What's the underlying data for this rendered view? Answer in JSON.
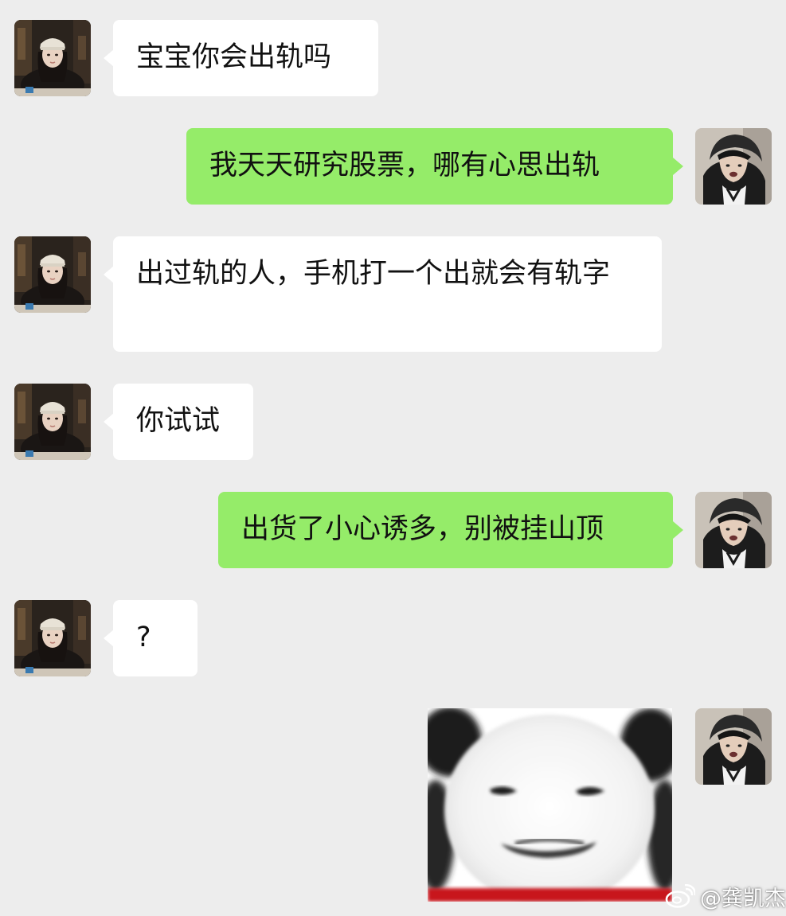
{
  "chat": {
    "messages": [
      {
        "side": "left",
        "text": "宝宝你会出轨吗"
      },
      {
        "side": "right",
        "text": "我天天研究股票，哪有心思出轨"
      },
      {
        "side": "left",
        "text": "出过轨的人，手机打一个出就会有轨字"
      },
      {
        "side": "left",
        "text": "你试试"
      },
      {
        "side": "right",
        "text": "出货了小心诱多，别被挂山顶"
      },
      {
        "side": "left",
        "text": "?"
      },
      {
        "side": "right",
        "sticker": "panda-meme-sticker"
      }
    ]
  },
  "avatars": {
    "left": "girl-avatar",
    "right": "boy-avatar"
  },
  "watermark": {
    "icon": "weibo-icon",
    "text": "@龚凯杰"
  },
  "colors": {
    "background": "#ededed",
    "incoming_bubble": "#ffffff",
    "outgoing_bubble": "#95ec69",
    "text": "#111111"
  }
}
